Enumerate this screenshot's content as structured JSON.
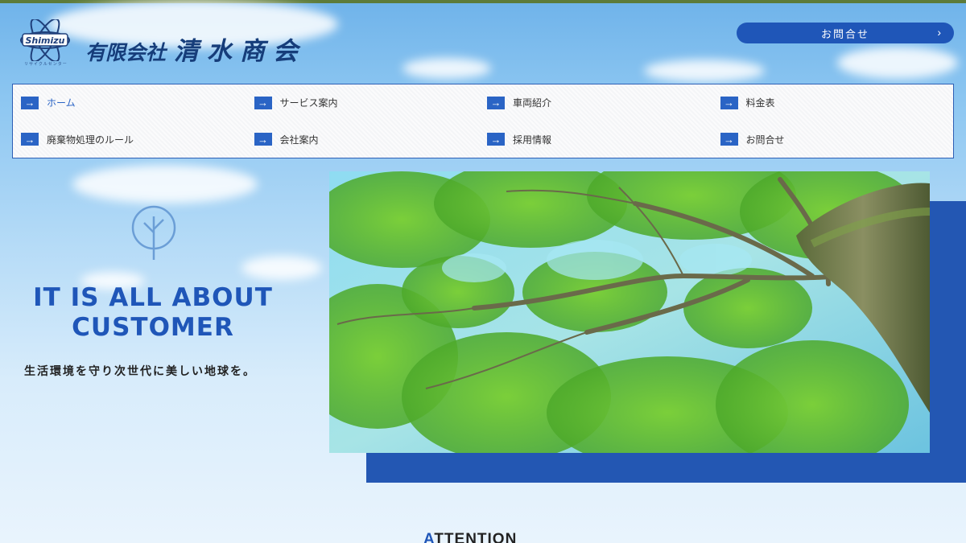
{
  "header": {
    "logo_text": "Shimizu",
    "logo_subtext": "リサイクルセンター",
    "company_prefix": "有限会社",
    "company_name": "清水商会",
    "contact_button": "お問合せ"
  },
  "nav": {
    "items": [
      {
        "label": "ホーム",
        "active": true
      },
      {
        "label": "サービス案内"
      },
      {
        "label": "車両紹介"
      },
      {
        "label": "料金表"
      },
      {
        "label": "廃棄物処理のルール"
      },
      {
        "label": "会社案内"
      },
      {
        "label": "採用情報"
      },
      {
        "label": "お問合せ"
      }
    ]
  },
  "hero": {
    "title_line1": "IT IS ALL ABOUT",
    "title_line2": "CUSTOMER",
    "subtitle": "生活環境を守り次世代に美しい地球を。"
  },
  "section": {
    "heading_first": "A",
    "heading_rest": "TTENTION"
  },
  "colors": {
    "accent": "#1f56b8",
    "nav_arrow": "#2a64c5",
    "brand_dark": "#163d7a",
    "topbar": "#5d7b3a"
  },
  "icons": [
    "logo-atom-icon",
    "arrow-right-icon",
    "chevron-right-icon",
    "leaf-icon"
  ]
}
